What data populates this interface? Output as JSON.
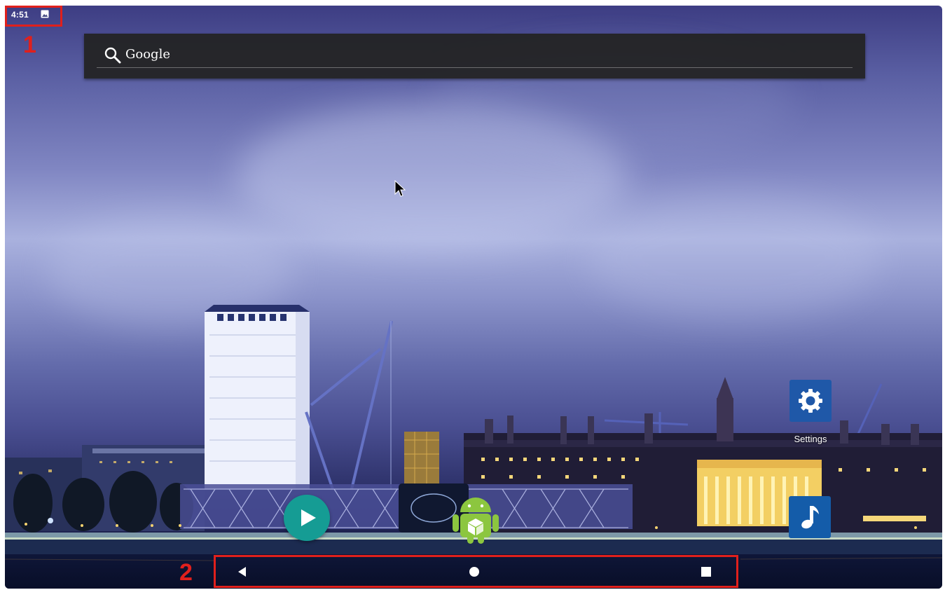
{
  "status_bar": {
    "time": "4:51",
    "notification_icon": "image-notification-icon"
  },
  "search_widget": {
    "label": "Google",
    "icon": "search-icon"
  },
  "home_screen": {
    "apps": [
      {
        "name": "Settings",
        "label": "Settings",
        "icon": "gear-icon",
        "color": "#1f58a8"
      },
      {
        "name": "Music",
        "label": "",
        "icon": "music-note-icon",
        "color": "#145ca9"
      },
      {
        "name": "Play Store",
        "label": "",
        "icon": "play-icon",
        "color": "#159c94"
      },
      {
        "name": "APK Installer",
        "label": "",
        "icon": "android-robot-icon",
        "color": "#8cc63f"
      }
    ]
  },
  "navigation_bar": {
    "back_icon": "back-triangle-icon",
    "home_icon": "home-circle-icon",
    "recents_icon": "recents-square-icon"
  },
  "annotations": [
    {
      "number": "1",
      "target": "status-bar",
      "color": "#e0201c"
    },
    {
      "number": "2",
      "target": "navigation-bar",
      "color": "#e0201c"
    }
  ],
  "wallpaper_colors": {
    "sky_top": "#3d3d83",
    "sky_glow": "#a9b1de",
    "river": "#111733",
    "building_lights": "#f5d77a"
  }
}
